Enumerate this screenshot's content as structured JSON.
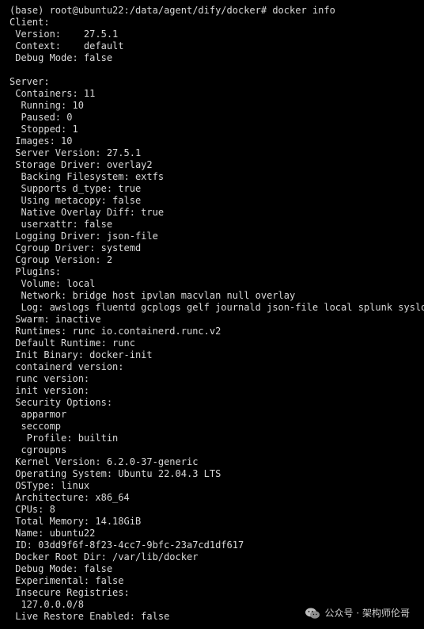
{
  "terminal": {
    "lines": [
      "(base) root@ubuntu22:/data/agent/dify/docker# docker info",
      "Client:",
      " Version:    27.5.1",
      " Context:    default",
      " Debug Mode: false",
      "",
      "Server:",
      " Containers: 11",
      "  Running: 10",
      "  Paused: 0",
      "  Stopped: 1",
      " Images: 10",
      " Server Version: 27.5.1",
      " Storage Driver: overlay2",
      "  Backing Filesystem: extfs",
      "  Supports d_type: true",
      "  Using metacopy: false",
      "  Native Overlay Diff: true",
      "  userxattr: false",
      " Logging Driver: json-file",
      " Cgroup Driver: systemd",
      " Cgroup Version: 2",
      " Plugins:",
      "  Volume: local",
      "  Network: bridge host ipvlan macvlan null overlay",
      "  Log: awslogs fluentd gcplogs gelf journald json-file local splunk syslog",
      " Swarm: inactive",
      " Runtimes: runc io.containerd.runc.v2",
      " Default Runtime: runc",
      " Init Binary: docker-init",
      " containerd version:",
      " runc version:",
      " init version:",
      " Security Options:",
      "  apparmor",
      "  seccomp",
      "   Profile: builtin",
      "  cgroupns",
      " Kernel Version: 6.2.0-37-generic",
      " Operating System: Ubuntu 22.04.3 LTS",
      " OSType: linux",
      " Architecture: x86_64",
      " CPUs: 8",
      " Total Memory: 14.18GiB",
      " Name: ubuntu22",
      " ID: 03dd9f6f-8f23-4cc7-9bfc-23a7cd1df617",
      " Docker Root Dir: /var/lib/docker",
      " Debug Mode: false",
      " Experimental: false",
      " Insecure Registries:",
      "  127.0.0.0/8",
      " Live Restore Enabled: false"
    ]
  },
  "watermark": {
    "text": "公众号 · 架构师伦哥",
    "icon": "wechat-icon"
  },
  "colors": {
    "background": "#000000",
    "text": "#d9d9d9"
  }
}
